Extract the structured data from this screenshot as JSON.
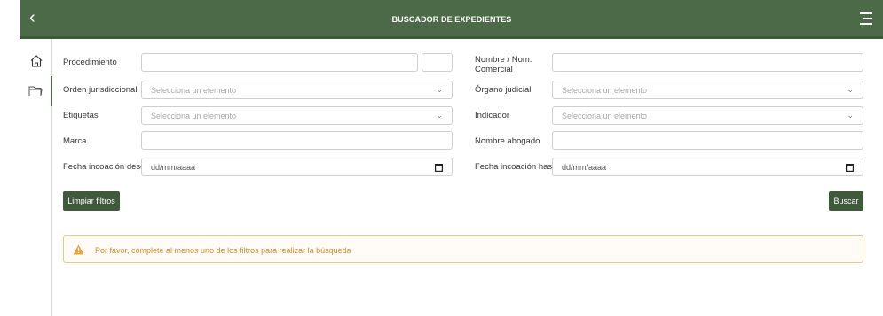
{
  "header": {
    "title": "BUSCADOR DE EXPEDIENTES",
    "back_icon": "chevron-left-icon",
    "menu_icon": "hamburger-menu-icon"
  },
  "sidebar": {
    "items": [
      {
        "icon": "home-icon",
        "active": false
      },
      {
        "icon": "folder-icon",
        "active": true
      }
    ]
  },
  "form": {
    "procedimiento": {
      "label": "Procedimiento",
      "value": "",
      "value2": ""
    },
    "nombre": {
      "label": "Nombre / Nom. Comercial",
      "value": ""
    },
    "orden": {
      "label": "Orden jurisdiccional",
      "placeholder": "Selecciona un elemento"
    },
    "organo": {
      "label": "Órgano judicial",
      "placeholder": "Selecciona un elemento"
    },
    "etiquetas": {
      "label": "Etiquetas",
      "placeholder": "Selecciona un elemento"
    },
    "indicador": {
      "label": "Indicador",
      "placeholder": "Selecciona un elemento"
    },
    "marca": {
      "label": "Marca",
      "value": ""
    },
    "abogado": {
      "label": "Nombre abogado",
      "value": ""
    },
    "fecha_desde": {
      "label": "Fecha incoación desde",
      "placeholder": "dd/mm/aaaa"
    },
    "fecha_hasta": {
      "label": "Fecha incoación hasta",
      "placeholder": "dd/mm/aaaa"
    }
  },
  "actions": {
    "clear_label": "Limpiar filtros",
    "search_label": "Buscar"
  },
  "alert": {
    "message": "Por favor, complete al menos uno de los filtros para realizar la búsqueda"
  },
  "colors": {
    "primary": "#4c6a47",
    "button": "#3e5a3a",
    "warning": "#e8a33d"
  }
}
